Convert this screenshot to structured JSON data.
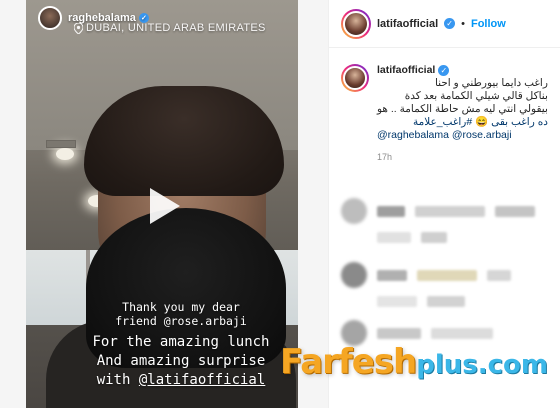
{
  "story": {
    "username": "raghebalama",
    "location": "DUBAI, UNITED ARAB EMIRATES",
    "caption_line1": "Thank you my dear",
    "caption_line2_prefix": "friend ",
    "caption_mention1": "@rose.arbaji",
    "caption_line3": "For the amazing lunch",
    "caption_line4": "And amazing surprise",
    "caption_line5_prefix": "with ",
    "caption_mention2": "@latifaofficial"
  },
  "post": {
    "username": "latifaofficial",
    "separator": "•",
    "follow_label": "Follow",
    "caption_username": "latifaofficial",
    "caption_lines": [
      "راغب دايما بيورطني و احنا",
      "بناكل قالي شيلي الكمامة بعد كدة",
      "بيقولي انتي ليه مش حاطة الكمامة .. هو",
      "ده راغب بقى 😄 #راغب_علامة"
    ],
    "mention1": "@raghebalama",
    "mention2": "@rose.arbaji",
    "time": "17h"
  },
  "watermark": {
    "brand": "Farfesh",
    "suffix": "plus.com"
  },
  "icons": {
    "play": "play-icon",
    "location": "location-pin-icon",
    "verified": "verified-badge-icon"
  }
}
